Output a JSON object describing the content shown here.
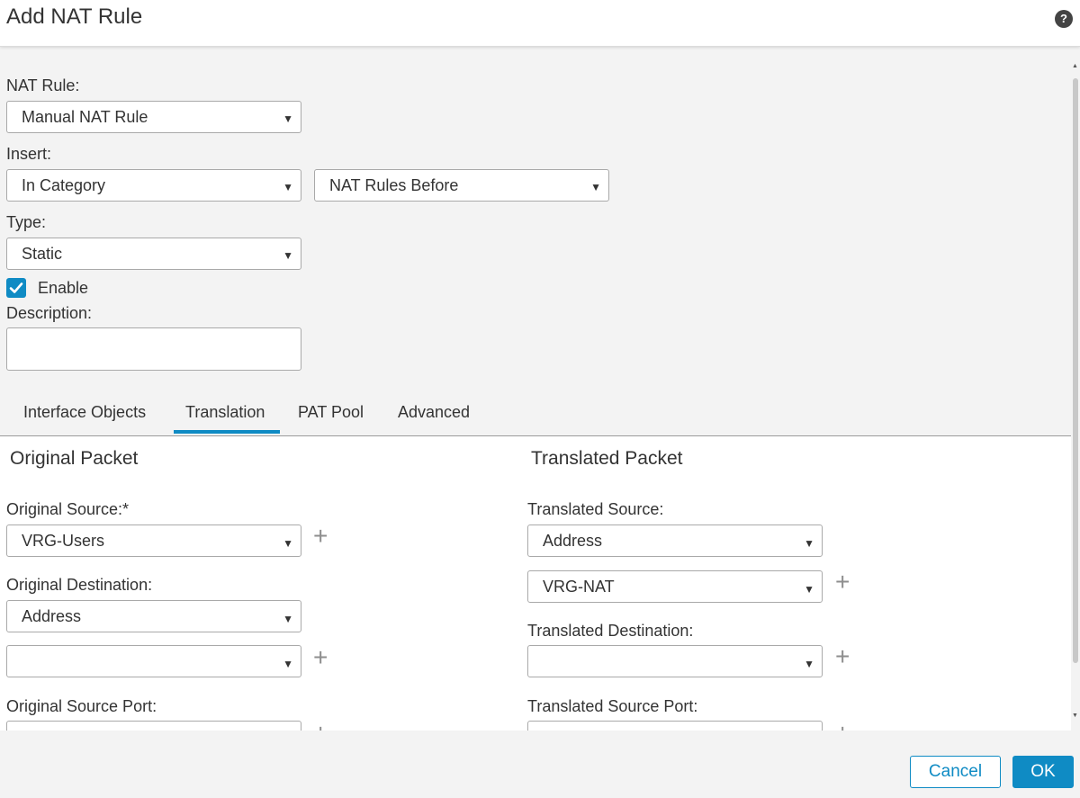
{
  "dialog": {
    "title": "Add NAT Rule",
    "help_icon": "?"
  },
  "form": {
    "nat_rule_label": "NAT Rule:",
    "nat_rule_value": "Manual NAT Rule",
    "insert_label": "Insert:",
    "insert_value": "In Category",
    "insert_position_value": "NAT Rules Before",
    "type_label": "Type:",
    "type_value": "Static",
    "enable_label": "Enable",
    "enable_checked": true,
    "description_label": "Description:",
    "description_value": ""
  },
  "tabs": [
    {
      "label": "Interface Objects",
      "active": false
    },
    {
      "label": "Translation",
      "active": true
    },
    {
      "label": "PAT Pool",
      "active": false
    },
    {
      "label": "Advanced",
      "active": false
    }
  ],
  "original_packet": {
    "title": "Original Packet",
    "source_label": "Original Source:*",
    "source_value": "VRG-Users",
    "destination_label": "Original Destination:",
    "destination_type_value": "Address",
    "destination_value": "",
    "source_port_label": "Original Source Port:"
  },
  "translated_packet": {
    "title": "Translated Packet",
    "source_label": "Translated Source:",
    "source_type_value": "Address",
    "source_value": "VRG-NAT",
    "destination_label": "Translated Destination:",
    "destination_value": "",
    "source_port_label": "Translated Source Port:"
  },
  "icons": {
    "dropdown": "▼",
    "add": "+"
  },
  "footer": {
    "cancel_label": "Cancel",
    "ok_label": "OK"
  },
  "colors": {
    "accent": "#0f8bc4",
    "panel_bg": "#f3f3f3",
    "content_bg": "#ffffff"
  }
}
